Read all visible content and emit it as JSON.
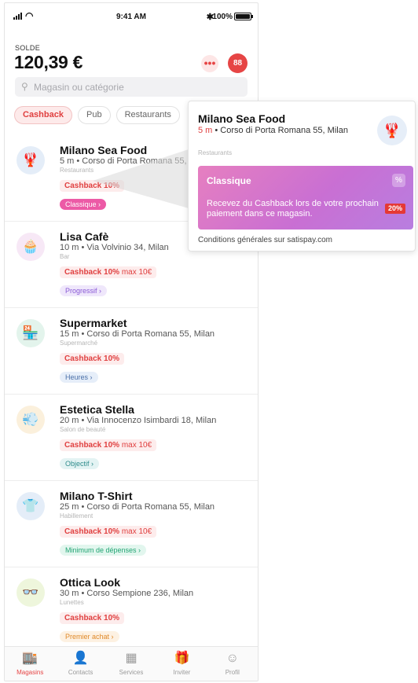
{
  "status": {
    "time": "9:41 AM",
    "bluetooth": "✱",
    "battery": "100%"
  },
  "balance": {
    "label": "SOLDE",
    "value": "120,39 €"
  },
  "header": {
    "more_icon": "•••",
    "grid_icon": "88"
  },
  "search": {
    "placeholder": "Magasin ou catégorie"
  },
  "chips": [
    "Cashback",
    "Pub",
    "Restaurants"
  ],
  "stores": [
    {
      "name": "Milano Sea Food",
      "address": "5 m • Corso di Porta Romana 55, Milan",
      "category": "Restaurants",
      "cashback": "Cashback 10%",
      "max": "",
      "tag": "Classique ›",
      "icon": "lobster-icon",
      "glyph": "🦞",
      "avatar_bg": "#e4edf8",
      "tag_bg": "#ec5aa6",
      "tag_color": "#ffffff"
    },
    {
      "name": "Lisa Cafè",
      "address": "10 m • Via Volvinio 34, Milan",
      "category": "Bar",
      "cashback": "Cashback 10%",
      "max": " max 10€",
      "tag": "Progressif ›",
      "icon": "cupcake-icon",
      "glyph": "🧁",
      "avatar_bg": "#f7e8f6",
      "tag_bg": "#efe7fb",
      "tag_color": "#8a5ad6"
    },
    {
      "name": "Supermarket",
      "address": "15 m • Corso di Porta Romana 55, Milan",
      "category": "Supermarché",
      "cashback": "Cashback 10%",
      "max": "",
      "tag": "Heures ›",
      "icon": "shop-icon",
      "glyph": "🏪",
      "avatar_bg": "#e3f4ec",
      "tag_bg": "#e6eef9",
      "tag_color": "#4a6fa8"
    },
    {
      "name": "Estetica Stella",
      "address": "20 m • Via Innocenzo Isimbardi 18, Milan",
      "category": "Salon de beauté",
      "cashback": "Cashback 10%",
      "max": " max 10€",
      "tag": "Objectif ›",
      "icon": "hairdryer-icon",
      "glyph": "💨",
      "avatar_bg": "#fbf0dc",
      "tag_bg": "#e3f3f3",
      "tag_color": "#2f8c8c"
    },
    {
      "name": "Milano T-Shirt",
      "address": "25 m • Corso di Porta Romana 55, Milan",
      "category": "Habillement",
      "cashback": "Cashback 10%",
      "max": " max 10€",
      "tag": "Minimum de dépenses ›",
      "icon": "tshirt-icon",
      "glyph": "👕",
      "avatar_bg": "#e4edf8",
      "tag_bg": "#e2f6ee",
      "tag_color": "#22a574"
    },
    {
      "name": "Ottica Look",
      "address": "30 m • Corso Sempione 236, Milan",
      "category": "Lunettes",
      "cashback": "Cashback 10%",
      "max": "",
      "tag": "Premier achat ›",
      "icon": "glasses-icon",
      "glyph": "👓",
      "avatar_bg": "#eef6dc",
      "tag_bg": "#fdf1e2",
      "tag_color": "#e08a2a"
    }
  ],
  "tabs": [
    {
      "label": "Magasins",
      "icon": "store-icon",
      "glyph": "🏬",
      "active": true
    },
    {
      "label": "Contacts",
      "icon": "contacts-icon",
      "glyph": "👤",
      "active": false
    },
    {
      "label": "Services",
      "icon": "services-icon",
      "glyph": "▦",
      "active": false
    },
    {
      "label": "Inviter",
      "icon": "gift-icon",
      "glyph": "🎁",
      "active": false
    },
    {
      "label": "Profil",
      "icon": "profile-icon",
      "glyph": "☺",
      "active": false
    }
  ],
  "popup": {
    "name": "Milano Sea Food",
    "distance": "5 m",
    "address": " • Corso di Porta Romana 55, Milan",
    "category": "Restaurants",
    "card_title": "Classique",
    "card_icon": "%",
    "card_desc": "Recevez du Cashback lors de votre prochain paiement dans ce magasin.",
    "card_badge": "20%",
    "footer": "Conditions générales sur satispay.com"
  },
  "colors": {
    "accent": "#e64545",
    "card_gradient_start": "#e67fc0",
    "card_gradient_end": "#b87ee0"
  }
}
